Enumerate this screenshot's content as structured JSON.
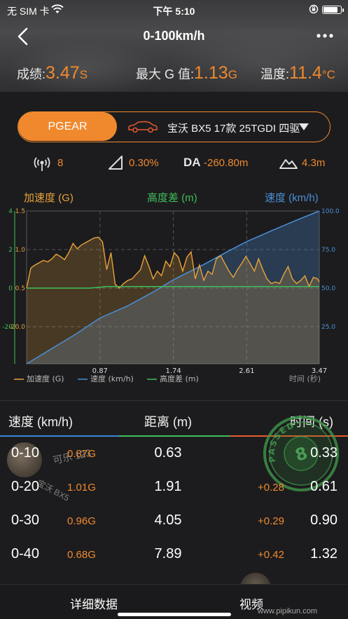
{
  "status_bar": {
    "carrier": "无 SIM 卡",
    "time": "下午 5:10",
    "battery_percent": 85
  },
  "nav": {
    "title": "0-100km/h"
  },
  "summary": {
    "score_label": "成绩:",
    "score_value": "3.47",
    "score_unit": "S",
    "g_label": "最大 G 值:",
    "g_value": "1.13",
    "g_unit": "G",
    "temp_label": "温度:",
    "temp_value": "11.4",
    "temp_unit": "°C"
  },
  "selector": {
    "mode_label": "PGEAR",
    "car_name": "宝沃 BX5 17款 25TGDI 四驱"
  },
  "metrics": {
    "satellites": "8",
    "slope": "0.30%",
    "da_label": "DA",
    "da_value": "-260.80m",
    "altitude": "4.3m"
  },
  "chart_data": {
    "type": "line",
    "series_headers": [
      "加速度 (G)",
      "高度差 (m)",
      "速度 (km/h)"
    ],
    "x": [
      0,
      0.87,
      1.74,
      2.61,
      3.47
    ],
    "x_ticks": [
      "0.87",
      "1.74",
      "2.61",
      "3.47"
    ],
    "xlabel": "时间 (秒)",
    "left_axis_outer": [
      "4",
      "2",
      "0",
      "-20"
    ],
    "left_axis_inner": [
      "1.5",
      "1.0",
      "0.5",
      "-20.0"
    ],
    "right_axis": [
      "100.0",
      "75.0",
      "50.0",
      "25.0"
    ],
    "series": [
      {
        "name": "加速度 (G)",
        "color": "#e9a33a",
        "x": [
          0,
          0.05,
          0.1,
          0.15,
          0.2,
          0.25,
          0.3,
          0.35,
          0.4,
          0.45,
          0.5,
          0.55,
          0.6,
          0.65,
          0.7,
          0.75,
          0.8,
          0.85,
          0.9,
          0.95,
          1.0,
          1.05,
          1.1,
          1.15,
          1.2,
          1.25,
          1.3,
          1.35,
          1.4,
          1.45,
          1.5,
          1.55,
          1.6,
          1.65,
          1.7,
          1.75,
          1.8,
          1.85,
          1.9,
          1.95,
          2.0,
          2.05,
          2.1,
          2.15,
          2.2,
          2.25,
          2.3,
          2.35,
          2.4,
          2.45,
          2.5,
          2.55,
          2.6,
          2.65,
          2.7,
          2.75,
          2.8,
          2.85,
          2.9,
          2.95,
          3.0,
          3.05,
          3.1,
          3.15,
          3.2,
          3.25,
          3.3,
          3.35,
          3.4,
          3.45,
          3.47
        ],
        "y": [
          0.5,
          0.76,
          0.8,
          0.83,
          0.86,
          0.84,
          0.88,
          0.94,
          0.91,
          0.87,
          0.96,
          1.08,
          1.01,
          1.06,
          1.09,
          1.12,
          1.15,
          1.16,
          1.1,
          0.74,
          0.96,
          0.55,
          0.5,
          0.56,
          0.6,
          0.62,
          0.68,
          0.74,
          0.92,
          0.78,
          0.62,
          0.72,
          0.66,
          0.85,
          0.78,
          0.96,
          0.9,
          0.72,
          0.9,
          0.97,
          0.62,
          0.8,
          0.6,
          0.72,
          0.68,
          0.88,
          0.92,
          0.82,
          0.72,
          0.64,
          0.74,
          0.82,
          0.91,
          0.82,
          0.72,
          0.88,
          0.74,
          0.62,
          0.56,
          0.58,
          0.56,
          0.68,
          0.78,
          0.62,
          0.56,
          0.6,
          0.66,
          0.52,
          0.64,
          0.62,
          0.58
        ]
      },
      {
        "name": "速度 (km/h)",
        "color": "#4a8fd6",
        "x": [
          0,
          0.3,
          0.6,
          0.87,
          1.2,
          1.5,
          1.74,
          2.1,
          2.4,
          2.61,
          2.9,
          3.2,
          3.47
        ],
        "y": [
          0,
          10,
          20,
          30,
          38,
          47,
          55,
          65,
          74,
          80,
          87,
          94,
          100
        ]
      },
      {
        "name": "高度差 (m)",
        "color": "#3fbf5a",
        "x": [
          0,
          0.75,
          0.95,
          1.2,
          1.74,
          2.61,
          3.47
        ],
        "y": [
          0.5,
          0.5,
          0.52,
          0.52,
          0.52,
          0.52,
          0.52
        ]
      }
    ],
    "legend": [
      "加速度 (G)",
      "速度 (km/h)",
      "高度差 (m)"
    ],
    "grid": true,
    "legend_position": "bottom"
  },
  "table": {
    "headers": {
      "speed": "速度 (km/h)",
      "distance": "距离 (m)",
      "time": "时间 (s)"
    },
    "header_colors": [
      "#3a86d8",
      "#3fbf5a",
      "#e65a2e"
    ],
    "rows": [
      {
        "range": "0-10",
        "g": "0.87G",
        "distance": "0.63",
        "delta": "",
        "time": "0.33"
      },
      {
        "range": "0-20",
        "g": "1.01G",
        "distance": "1.91",
        "delta": "+0.28",
        "time": "0.61"
      },
      {
        "range": "0-30",
        "g": "0.96G",
        "distance": "4.05",
        "delta": "+0.29",
        "time": "0.90"
      },
      {
        "range": "0-40",
        "g": "0.68G",
        "distance": "7.89",
        "delta": "+0.42",
        "time": "1.32"
      }
    ],
    "watermark_user": "可乐 123",
    "watermark_car": "宝沃 BX5",
    "stamp_text": "PASSED",
    "stamp_number": "8"
  },
  "tabs": {
    "details": "详细数据",
    "video": "视频"
  },
  "footer": {
    "watermark": "www.pipikun.com"
  }
}
